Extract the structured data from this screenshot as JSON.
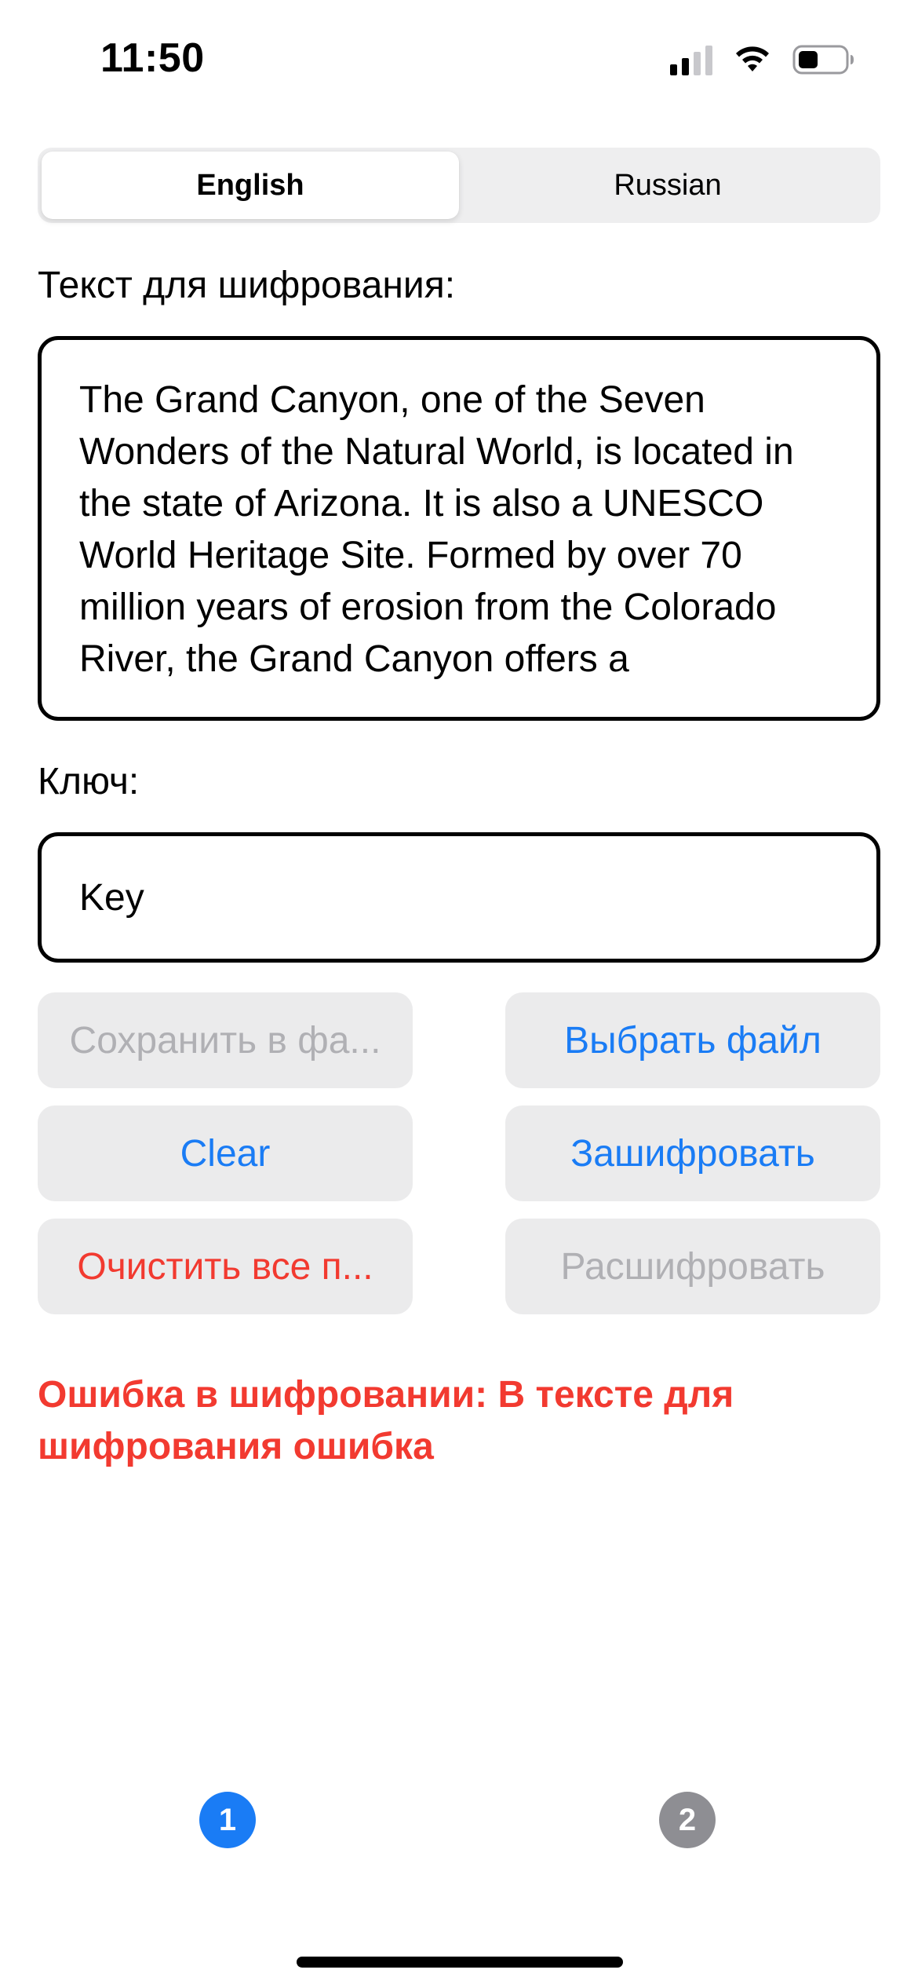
{
  "status_bar": {
    "time": "11:50"
  },
  "segmented": {
    "options": [
      "English",
      "Russian"
    ],
    "selected": "English"
  },
  "encrypt_text": {
    "label": "Текст для шифрования:",
    "value": "The Grand Canyon, one of the Seven Wonders of the Natural World, is located in the state of Arizona. It is also a UNESCO World Heritage Site. Formed by over 70 million years of erosion from the Colorado River, the Grand Canyon offers a"
  },
  "key": {
    "label": "Ключ:",
    "value": "Key"
  },
  "buttons": {
    "save_to_file": "Сохранить в фа...",
    "choose_file": "Выбрать файл",
    "clear": "Clear",
    "encrypt": "Зашифровать",
    "clear_all": "Очистить все п...",
    "decrypt": "Расшифровать"
  },
  "colors": {
    "accent": "#1a7cf5",
    "error": "#f23a30",
    "disabled_text": "#b0b0b4",
    "button_bg": "#ebebec"
  },
  "error_message": "Ошибка в шифровании: В тексте для шифрования ошибка",
  "pages": {
    "items": [
      "1",
      "2"
    ],
    "active": "1"
  }
}
